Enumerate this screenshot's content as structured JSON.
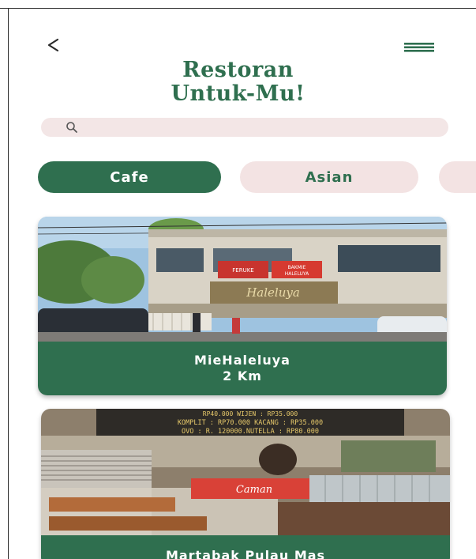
{
  "header": {
    "back_icon": "chevron-left-icon",
    "menu_icon": "hamburger-menu-icon",
    "title_line1": "Restoran",
    "title_line2": "Untuk-Mu!"
  },
  "search": {
    "icon": "search-icon",
    "placeholder": "",
    "value": ""
  },
  "categories": [
    {
      "label": "Cafe",
      "selected": true
    },
    {
      "label": "Asian",
      "selected": false
    },
    {
      "label": "",
      "selected": false
    }
  ],
  "restaurants": [
    {
      "name": "MieHaleluya",
      "distance": "2 Km"
    },
    {
      "name": "Martabak Pulau Mas",
      "distance": ""
    }
  ],
  "photo_signs": {
    "card1_sign_left": "FERUKE",
    "card1_sign_right": "BAKMIE\nHALELUYA",
    "card1_banner": "Haleluya",
    "card2_menu_line1": "KOMPLIT : RP70.000  KACANG : RP35.000",
    "card2_menu_line2": "OVO   : R. 120000.NUTELLA : RP80.000",
    "card2_menu_line0": "RP40.000   WIJEN : RP35.000",
    "card2_can": "Caman"
  },
  "colors": {
    "primary_green": "#2f6f4f",
    "chip_pink": "#f3e3e3",
    "search_pink": "#f3e6e6"
  }
}
